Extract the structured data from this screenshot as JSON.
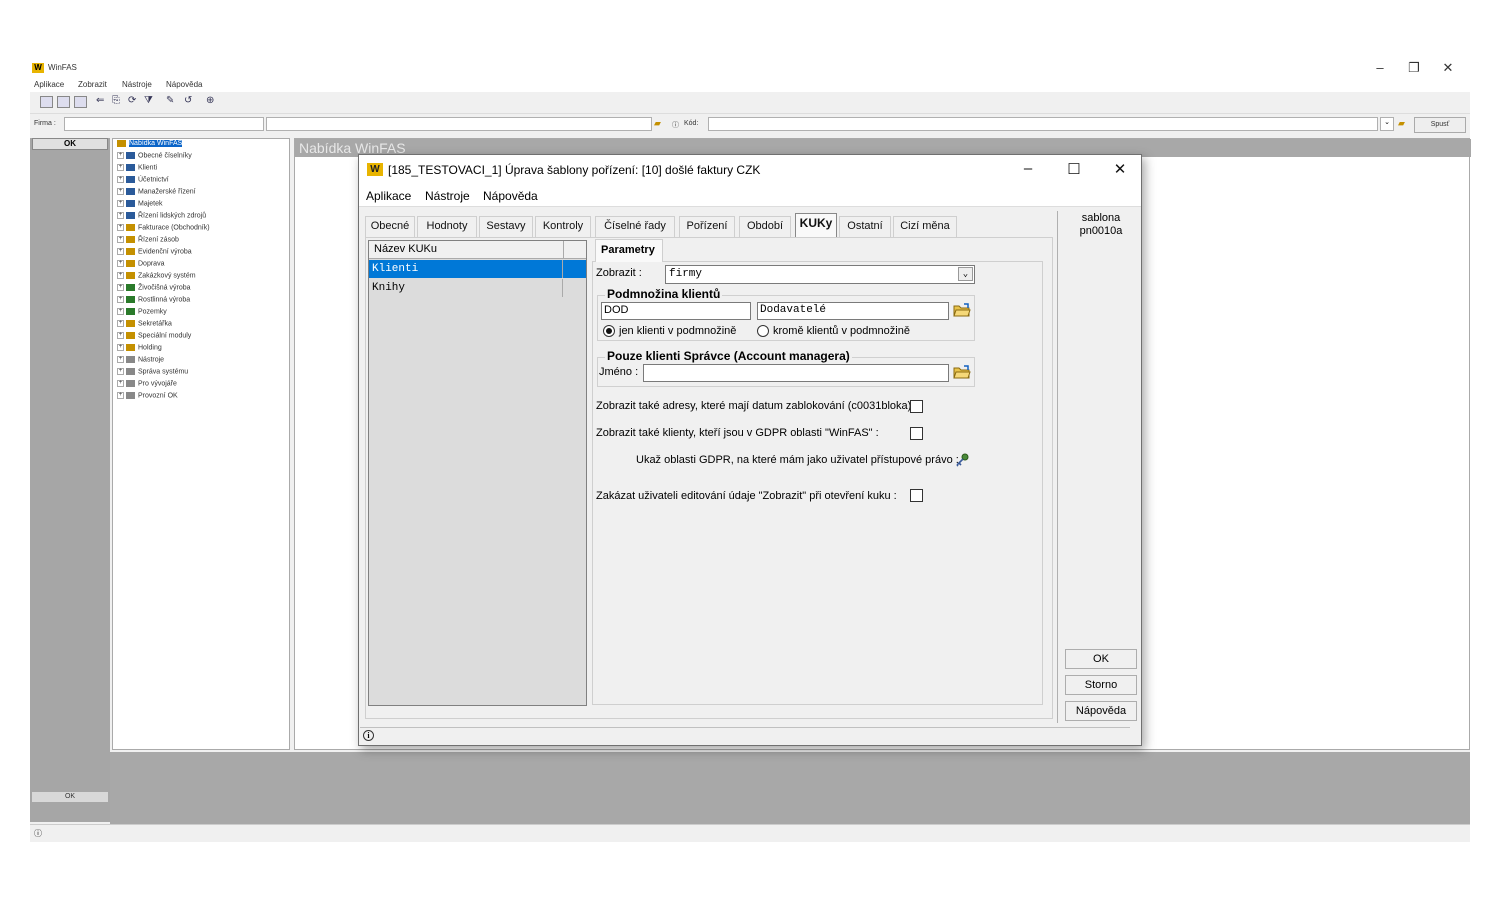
{
  "app": {
    "title": "WinFAS",
    "menu": [
      "Aplikace",
      "Zobrazit",
      "Nástroje",
      "Nápověda"
    ],
    "firma_label": "Firma :",
    "kod_label": "Kód:",
    "spust_label": "Spusť",
    "left_ok": "OK",
    "left_ok2": "OK",
    "content_title": "Nabídka WinFAS",
    "tree": [
      "Nabídka WinFAS",
      "Obecné číselníky",
      "Klienti",
      "Účetnictví",
      "Manažerské řízení",
      "Majetek",
      "Řízení lidských zdrojů",
      "Fakturace (Obchodník)",
      "Řízení zásob",
      "Evidenční výroba",
      "Doprava",
      "Zakázkový systém",
      "Živočišná výroba",
      "Rostlinná výroba",
      "Pozemky",
      "Sekretářka",
      "Speciální moduly",
      "Holding",
      "Nástroje",
      "Správa systému",
      "Pro vývojáře",
      "Provozní OK"
    ]
  },
  "dialog": {
    "title": "[185_TESTOVACI_1] Úprava šablony pořízení: [10] došlé faktury CZK",
    "menu": [
      "Aplikace",
      "Nástroje",
      "Nápověda"
    ],
    "tabs": [
      "Obecné",
      "Hodnoty",
      "Sestavy",
      "Kontroly",
      "Číselné řady",
      "Pořízení",
      "Období",
      "KUKy",
      "Ostatní",
      "Cizí měna"
    ],
    "list_header": "Název KUKu",
    "list_items": [
      "Klienti",
      "Knihy"
    ],
    "param_tab": "Parametry",
    "zobrazit_label": "Zobrazit :",
    "zobrazit_value": "firmy",
    "podmnozina_title": "Podmnožina klientů",
    "podmnozina_code": "DOD",
    "podmnozina_name": "Dodavatelé",
    "radio_in": "jen klienti v podmnožině",
    "radio_out": "kromě klientů v podmnožině",
    "spravce_title": "Pouze klienti Správce (Account managera)",
    "jmeno_label": "Jméno :",
    "jmeno_value": "",
    "chk1_label": "Zobrazit také adresy, které mají datum zablokování (c0031bloka) :",
    "chk2_label": "Zobrazit také klienty, kteří jsou v GDPR oblasti \"WinFAS\" :",
    "gdpr_label": "Ukaž oblasti GDPR, na které mám jako uživatel přístupové právo :",
    "chk3_label": "Zakázat uživateli editování údaje \"Zobrazit\" při otevření kuku :",
    "side_label_1": "sablona",
    "side_label_2": "pn0010a",
    "ok": "OK",
    "storno": "Storno",
    "help": "Nápověda"
  }
}
